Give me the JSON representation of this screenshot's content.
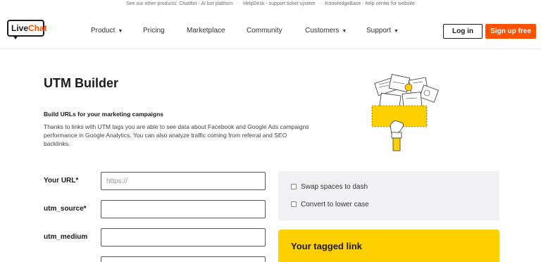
{
  "topbar": {
    "intro": "See our other products:",
    "items": [
      "ChatBot - AI bot platform",
      "HelpDesk - support ticket system",
      "KnowledgeBase - help center for website"
    ]
  },
  "logo": {
    "part1": "Live",
    "part2": "Chat"
  },
  "nav": {
    "items": [
      {
        "label": "Product",
        "caret": true
      },
      {
        "label": "Pricing",
        "caret": false
      },
      {
        "label": "Marketplace",
        "caret": false
      },
      {
        "label": "Community",
        "caret": false
      },
      {
        "label": "Customers",
        "caret": true
      },
      {
        "label": "Support",
        "caret": true
      }
    ],
    "login": "Log in",
    "signup": "Sign up free"
  },
  "page": {
    "title": "UTM Builder",
    "subtitle": "Build URLs for your marketing campaigns",
    "description": "Thanks to links with UTM tags you are able to see data about Facebook and Google Ads campaigns performance in Google Analytics. You can also analyze traffic coming from referral and SEO backlinks."
  },
  "form": {
    "url_label": "Your URL*",
    "url_placeholder": "https://",
    "source_label": "utm_source*",
    "medium_label": "utm_medium"
  },
  "options": {
    "swap_label": "Swap spaces to dash",
    "swap_checked": false,
    "lower_label": "Convert to lower case",
    "lower_checked": false
  },
  "result": {
    "title": "Your tagged link"
  },
  "colors": {
    "brand": "#ff5100",
    "accent": "#ffd000",
    "text": "#1b1b20"
  }
}
